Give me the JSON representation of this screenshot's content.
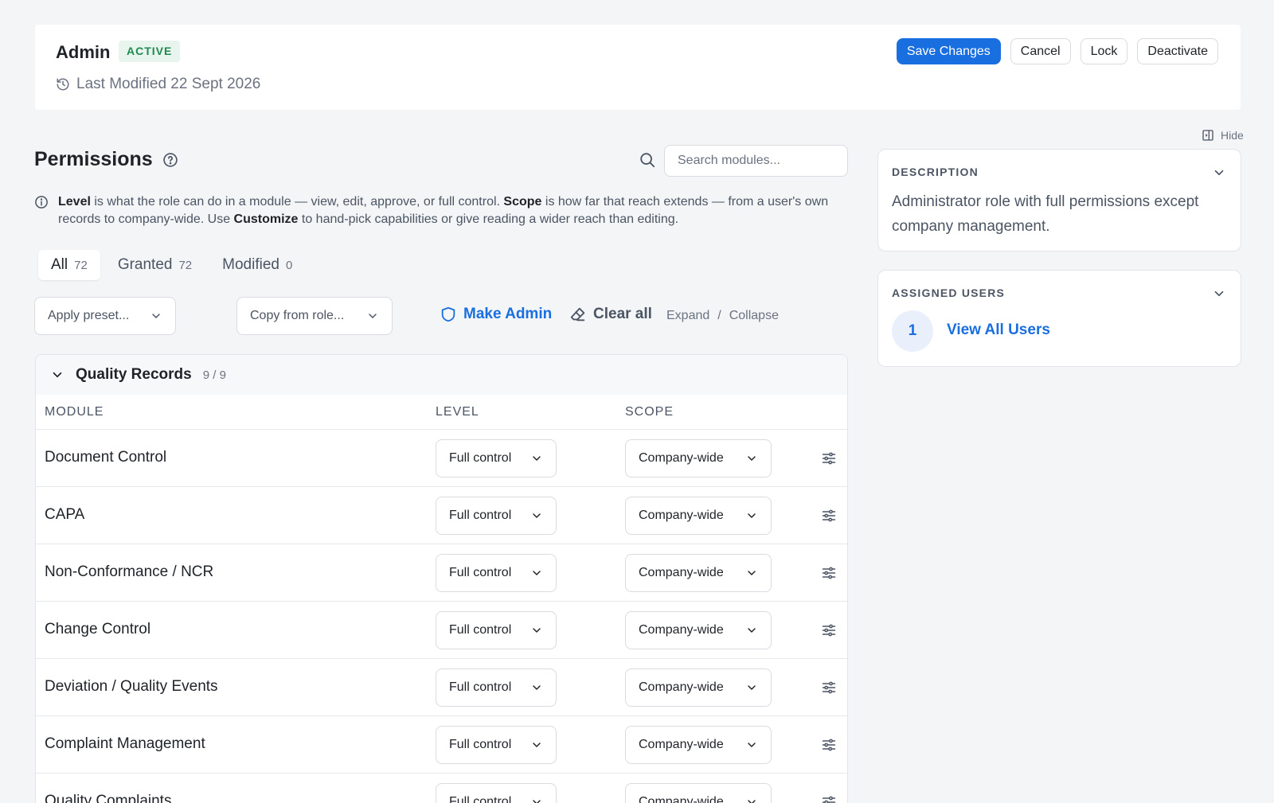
{
  "header": {
    "role_name": "Admin",
    "status": "ACTIVE",
    "last_modified": "Last Modified 22 Sept 2026",
    "buttons": {
      "save": "Save Changes",
      "cancel": "Cancel",
      "lock": "Lock",
      "deactivate": "Deactivate"
    }
  },
  "permissions": {
    "title": "Permissions",
    "search_placeholder": "Search modules...",
    "info": {
      "level_word": "Level",
      "text1": " is what the role can do in a module — view, edit, approve, or full control. ",
      "scope_word": "Scope",
      "text2": " is how far that reach extends — from a user's own records to company-wide. Use ",
      "customize_word": "Customize",
      "text3": " to hand-pick capabilities or give reading a wider reach than editing."
    },
    "tabs": [
      {
        "label": "All",
        "count": "72"
      },
      {
        "label": "Granted",
        "count": "72"
      },
      {
        "label": "Modified",
        "count": "0"
      }
    ],
    "toolbar": {
      "preset": "Apply preset...",
      "copy_role": "Copy from role...",
      "make_admin": "Make Admin",
      "clear_all": "Clear all",
      "expand": "Expand",
      "separator": "/",
      "collapse": "Collapse"
    },
    "group": {
      "title": "Quality Records",
      "count": "9 / 9"
    },
    "columns": {
      "module": "MODULE",
      "level": "LEVEL",
      "scope": "SCOPE"
    },
    "rows": [
      {
        "module": "Document Control",
        "level": "Full control",
        "scope": "Company-wide"
      },
      {
        "module": "CAPA",
        "level": "Full control",
        "scope": "Company-wide"
      },
      {
        "module": "Non-Conformance / NCR",
        "level": "Full control",
        "scope": "Company-wide"
      },
      {
        "module": "Change Control",
        "level": "Full control",
        "scope": "Company-wide"
      },
      {
        "module": "Deviation / Quality Events",
        "level": "Full control",
        "scope": "Company-wide"
      },
      {
        "module": "Complaint Management",
        "level": "Full control",
        "scope": "Company-wide"
      },
      {
        "module": "Quality Complaints",
        "level": "Full control",
        "scope": "Company-wide"
      }
    ]
  },
  "sidebar": {
    "hide_label": "Hide",
    "description": {
      "label": "DESCRIPTION",
      "text": "Administrator role with full permissions except company management."
    },
    "assigned_users": {
      "label": "ASSIGNED USERS",
      "count": "1",
      "link": "View All Users"
    }
  },
  "colors": {
    "accent": "#1a6fe0",
    "active_badge_bg": "#e8f5ee",
    "active_badge_text": "#1f8a52"
  }
}
